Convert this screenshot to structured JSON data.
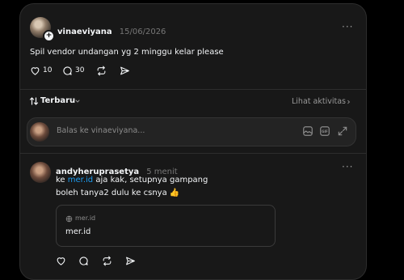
{
  "post": {
    "username": "vinaeviyana",
    "date": "15/06/2026",
    "text": "Spil vendor undangan yg 2 minggu kelar please",
    "likes": "10",
    "comments": "30",
    "more": "···"
  },
  "sort": {
    "label": "Terbaru",
    "activity_label": "Lihat aktivitas"
  },
  "reply_box": {
    "placeholder": "Balas ke vinaeviyana..."
  },
  "comment": {
    "username": "andyheruprasetya",
    "time": "5 menit",
    "line1_prefix": "ke ",
    "line1_link": "mer.id",
    "line1_suffix": " aja kak, setupnya gampang",
    "line2": "boleh tanya2 dulu ke csnya 👍",
    "more": "···",
    "card": {
      "domain": "mer.id",
      "title": "mer.id"
    }
  },
  "icons": {
    "like": "heart-icon",
    "comment": "comment-icon",
    "repost": "repost-icon",
    "share": "send-icon",
    "sort": "sort-arrows-icon",
    "image": "image-icon",
    "gif": "gif-icon",
    "expand": "expand-icon",
    "globe": "globe-icon"
  }
}
